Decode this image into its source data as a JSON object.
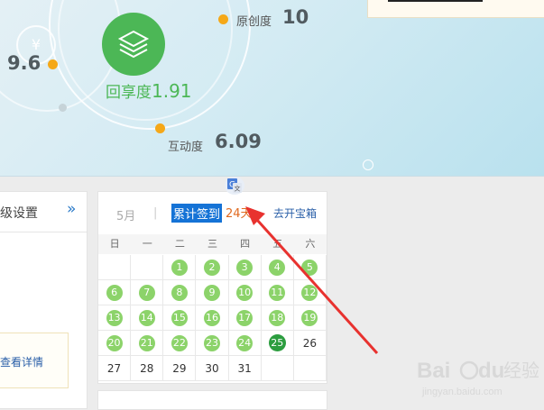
{
  "banner": {
    "left_score": "9.6",
    "return_label": "回享度",
    "return_value": "1.91",
    "original_label": "原创度",
    "original_value": "10",
    "interaction_label": "互动度",
    "interaction_value": "6.09",
    "house_glyph": "¥"
  },
  "left_panel": {
    "title": "级设置",
    "expand_arrows": "»",
    "detail_link": "查看详情"
  },
  "calendar": {
    "month": "5月",
    "separator": "|",
    "accumulated_label": "累计签到",
    "accumulated_value": "24天",
    "treasure_link": "去开宝箱",
    "weekdays": [
      "日",
      "一",
      "二",
      "三",
      "四",
      "五",
      "六"
    ],
    "today": 25,
    "checked_days": [
      1,
      2,
      3,
      4,
      5,
      6,
      7,
      8,
      9,
      10,
      11,
      12,
      13,
      14,
      15,
      16,
      17,
      18,
      19,
      20,
      21,
      22,
      23,
      24,
      25
    ],
    "rows": [
      [
        "",
        "",
        "1",
        "2",
        "3",
        "4",
        "5"
      ],
      [
        "6",
        "7",
        "8",
        "9",
        "10",
        "11",
        "12"
      ],
      [
        "13",
        "14",
        "15",
        "16",
        "17",
        "18",
        "19"
      ],
      [
        "20",
        "21",
        "22",
        "23",
        "24",
        "25",
        "26"
      ],
      [
        "27",
        "28",
        "29",
        "30",
        "31",
        "",
        ""
      ]
    ]
  },
  "colors": {
    "accent_green": "#4cb756",
    "checked_bubble": "#8cd36a",
    "today_bubble": "#2c9d3f",
    "highlight_blue": "#1573d6",
    "orange_dot": "#f5a818",
    "annotation_red": "#e8322f"
  },
  "icons": {
    "translate": "google-translate-icon",
    "layers": "layers-icon",
    "house": "house-icon"
  },
  "watermark": {
    "brand": "Bai",
    "brand_suffix": "du",
    "product": "经验",
    "url": "jingyan.baidu.com"
  }
}
